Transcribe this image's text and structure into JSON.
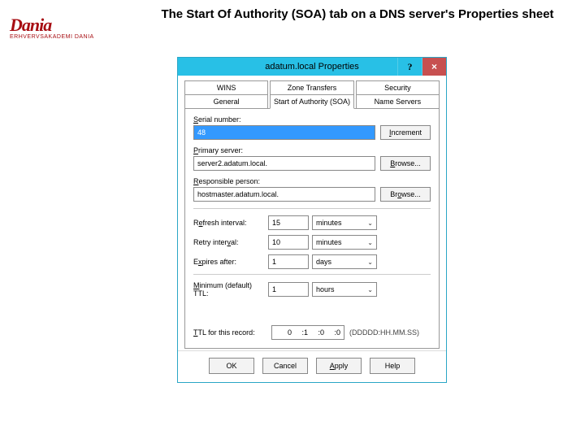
{
  "slide": {
    "title": "The Start Of Authority (SOA) tab on a DNS server's Properties sheet"
  },
  "logo": {
    "script": "Dania",
    "sub": "ERHVERVSAKADEMI DANIA"
  },
  "dialog": {
    "title": "adatum.local Properties",
    "help": "?",
    "close": "×",
    "tabs_row1": [
      "WINS",
      "Zone Transfers",
      "Security"
    ],
    "tabs_row2": [
      "General",
      "Start of Authority (SOA)",
      "Name Servers"
    ],
    "active_tab": "Start of Authority (SOA)",
    "serial": {
      "label": "Serial number:",
      "value": "48"
    },
    "increment_btn": "Increment",
    "primary": {
      "label": "Primary server:",
      "value": "server2.adatum.local."
    },
    "browse1_btn": "Browse...",
    "responsible": {
      "label": "Responsible person:",
      "value": "hostmaster.adatum.local."
    },
    "browse2_btn": "Browse...",
    "refresh": {
      "label": "Refresh interval:",
      "value": "15",
      "unit": "minutes"
    },
    "retry": {
      "label": "Retry interval:",
      "value": "10",
      "unit": "minutes"
    },
    "expires": {
      "label": "Expires after:",
      "value": "1",
      "unit": "days"
    },
    "minimum": {
      "label": "Minimum (default) TTL:",
      "value": "1",
      "unit": "hours"
    },
    "ttl_record": {
      "label": "TTL for this record:",
      "d": "0",
      "h": ":1",
      "m": ":0",
      "s": ":0",
      "hint": "(DDDDD:HH.MM.SS)"
    },
    "buttons": {
      "ok": "OK",
      "cancel": "Cancel",
      "apply": "Apply",
      "help": "Help"
    }
  }
}
